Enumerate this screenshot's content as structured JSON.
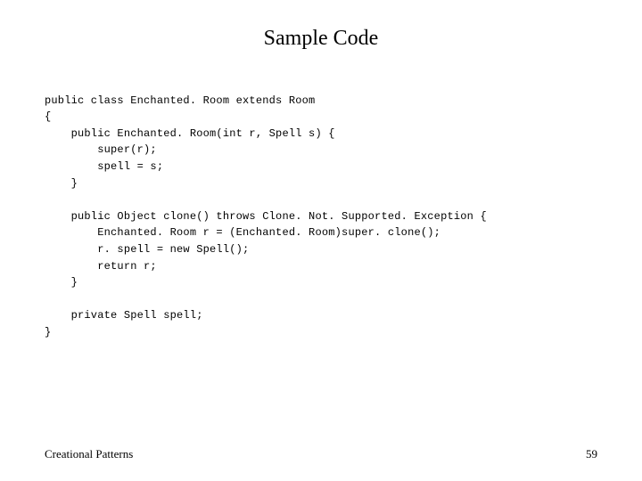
{
  "title": "Sample Code",
  "code": {
    "l01": "public class Enchanted. Room extends Room",
    "l02": "{",
    "l03": "    public Enchanted. Room(int r, Spell s) {",
    "l04": "        super(r);",
    "l05": "        spell = s;",
    "l06": "    }",
    "l07": "",
    "l08": "    public Object clone() throws Clone. Not. Supported. Exception {",
    "l09": "        Enchanted. Room r = (Enchanted. Room)super. clone();",
    "l10": "        r. spell = new Spell();",
    "l11": "        return r;",
    "l12": "    }",
    "l13": "",
    "l14": "    private Spell spell;",
    "l15": "}"
  },
  "footer": {
    "left": "Creational Patterns",
    "right": "59"
  }
}
